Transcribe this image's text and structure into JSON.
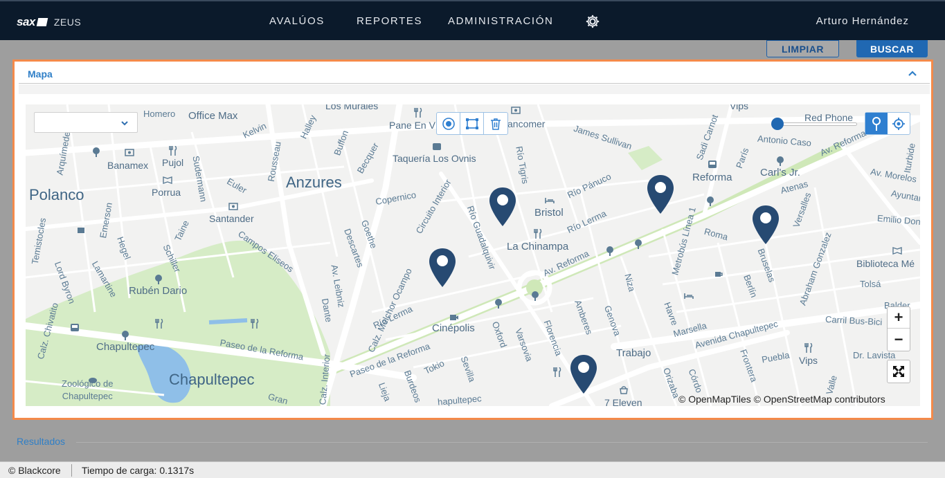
{
  "header": {
    "brand_logo": "sax",
    "brand_name": "ZEUS",
    "nav": [
      "AVALÚOS",
      "REPORTES",
      "ADMINISTRACIÓN"
    ],
    "settings_icon": "gear-icon",
    "user_name": "Arturo Hernández"
  },
  "actions": {
    "clear_label": "LIMPIAR",
    "search_label": "BUSCAR"
  },
  "map_panel": {
    "title": "Mapa",
    "collapse_icon": "chevron-up-icon",
    "layer_select": {
      "value": "",
      "icon": "chevron-down-icon"
    },
    "draw_tools": [
      "circle-draw-icon",
      "rectangle-draw-icon",
      "trash-icon"
    ],
    "mode_buttons": [
      "pin-mode-icon",
      "locate-icon"
    ],
    "zoom_in": "+",
    "zoom_out": "−",
    "fullscreen_icon": "fullscreen-icon",
    "attribution": "© OpenMapTiles © OpenStreetMap contributors",
    "marker_count": 5,
    "labels": {
      "polanco": "Polanco",
      "anzures": "Anzures",
      "chapultepec": "Chapultepec",
      "reforma": "Reforma",
      "los_murales": "Los Murales",
      "homero": "Homero",
      "office_max": "Office Max",
      "pane_en_v": "Pane En V",
      "vancomer": "ancomer",
      "vips_top": "Vips",
      "red_phone": "Red Phone",
      "kelvin": "Kelvin",
      "halley": "Halley",
      "buffon": "Buffon",
      "becquer": "Becquer",
      "taqueria": "Taquería Los Ovnis",
      "rio_tigris": "Río Tigris",
      "james_sullivan": "James Sullivan",
      "sadi_carnot": "Sadi Carnot",
      "antonio_caso": "Antonio Caso",
      "av_reforma_top": "Av. Reforma",
      "iturbide": "Iturbide",
      "arquimedes": "Arquímedes",
      "banamex": "Banamex",
      "pujol": "Pujol",
      "sudermann": "Sudermann",
      "rousseau": "Rousseau",
      "euler": "Euler",
      "paris": "París",
      "carls_jr": "Carl's Jr.",
      "av_morelos": "Av. Morelos",
      "porrua": "Porrua",
      "copernico": "Copernico",
      "circuito_interior": "Circuito Interior",
      "rio_panuco": "Río Pánuco",
      "atenas": "Atenas",
      "ayuntamiento": "Ayuntam",
      "bristol": "Bristol",
      "rio_guadalquivir": "Río Guadalquivir",
      "rio_lerma_top": "Río Lerma",
      "versalles": "Versalles",
      "emerson": "Emerson",
      "santander": "Santander",
      "goethe": "Goethe",
      "temistocles": "Temistocles",
      "taine": "Taine",
      "metrobus": "Metrobús Línea 1",
      "roma": "Roma",
      "emilio_donde": "Emilio Dondé",
      "hegel": "Hegel",
      "campos_eliseos": "Campos Eliseos",
      "descartes": "Descartes",
      "la_chinampa": "La Chinampa",
      "schiller": "Schiller",
      "lord_byron": "Lord Byron",
      "lamartine": "Lamartine",
      "calz_melchor": "Calz. Melchor Ocampo",
      "av_reforma_mid": "Av. Reforma",
      "bruselas": "Bruselas",
      "abraham_gonzalez": "Abraham Gonzalez",
      "biblioteca": "Biblioteca Mé",
      "av_leibniz": "Av. Leibniz",
      "niza": "Niza",
      "berlin": "Berlín",
      "tolsa": "Tolsá",
      "ruben_dario": "Rubén Dario",
      "dante": "Dante",
      "rio_lerma_low": "Río Lerma",
      "calz_chivatito": "Calz. Chivatito",
      "amberes": "Amberes",
      "havre": "Havre",
      "balderas": "Balder",
      "genova": "Genova",
      "cinepolis": "Cinépolis",
      "oxford": "Oxford",
      "varsovia": "Varsovia",
      "florencia": "Florencia",
      "marsella": "Marsella",
      "carril_bus": "Carril Bus-Bici",
      "av_chapultepec": "Avenida Chapultepec",
      "chapultepec_small": "Chapultepec",
      "paseo_reforma_left": "Paseo de la Reforma",
      "paseo_reforma_low": "Paseo de la Reforma",
      "trabajo": "Trabajo",
      "dr_lavista": "Dr. Lavista",
      "vips_bottom": "Vips",
      "puebla": "Puebla",
      "frontera": "Frontera",
      "zoologico": "Zoológico de\nChapultepec",
      "tokio": "Tokio",
      "sevilla": "Sevilla",
      "burdeos": "Burdeos",
      "lieja": "Lieja",
      "calz_interior": "Calz. Interior",
      "orizaba": "Orizaba",
      "cordoba": "Córdo",
      "valle": "Valle",
      "seven_eleven": "7 Eleven",
      "gran": "Gran",
      "chapultepec_bottom": "hapultepec"
    }
  },
  "results": {
    "title": "Resultados"
  },
  "footer": {
    "copyright": "© Blackcore",
    "load_time": "Tiempo de carga: 0.1317s"
  }
}
